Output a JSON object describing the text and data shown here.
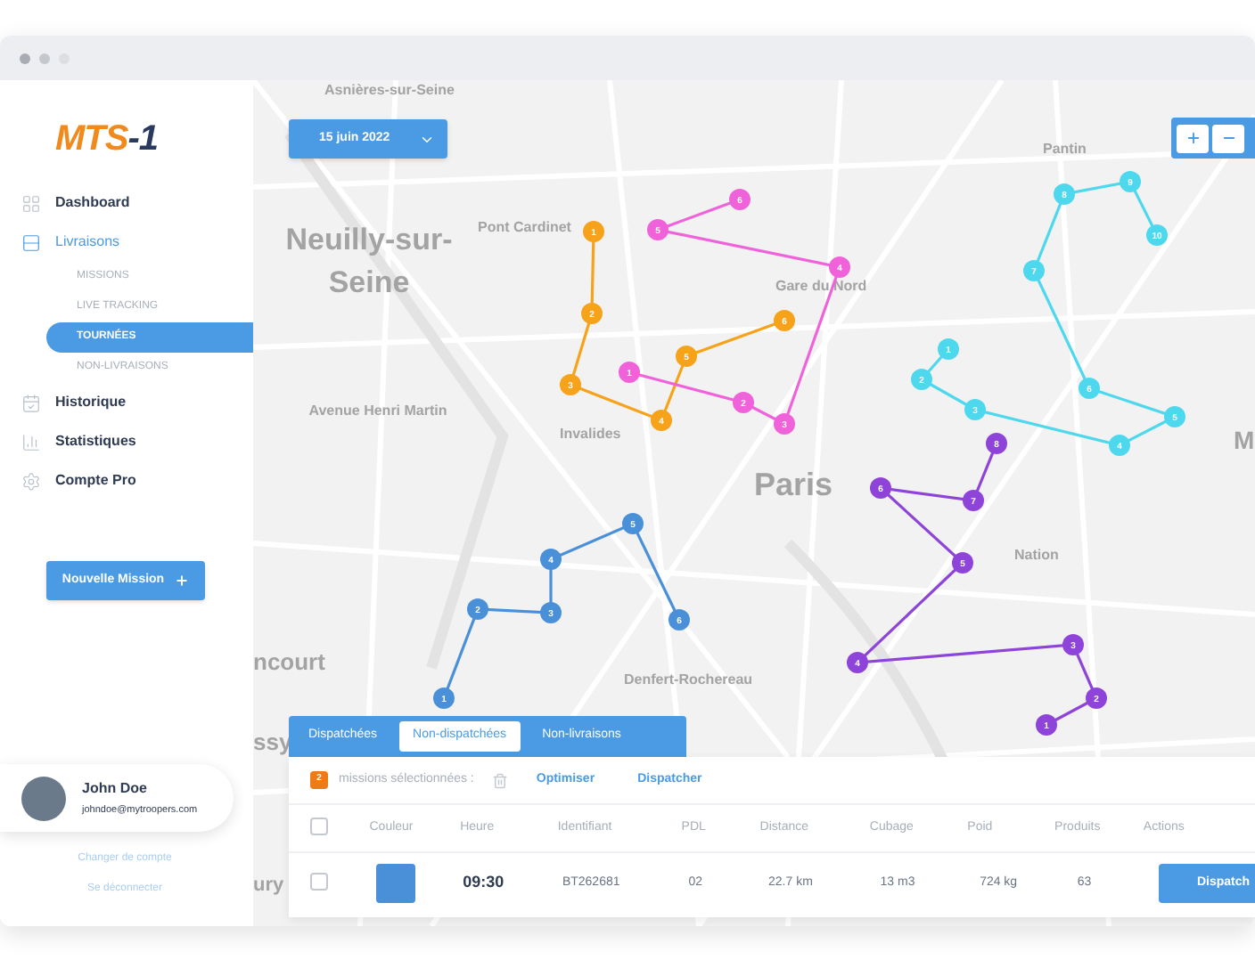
{
  "logo": {
    "main": "MTS",
    "suffix": "-1"
  },
  "nav": [
    {
      "label": "Dashboard",
      "expanded": false
    },
    {
      "label": "Livraisons",
      "expanded": true,
      "children": [
        {
          "label": "MISSIONS",
          "selected": false
        },
        {
          "label": "LIVE TRACKING",
          "selected": false
        },
        {
          "label": "TOURNÉES",
          "selected": true
        },
        {
          "label": "NON-LIVRAISONS",
          "selected": false
        }
      ]
    },
    {
      "label": "Historique",
      "expanded": false
    },
    {
      "label": "Statistiques",
      "expanded": false
    },
    {
      "label": "Compte Pro",
      "expanded": false
    }
  ],
  "new_mission_button": "Nouvelle Mission",
  "user": {
    "name": "John Doe",
    "email": "johndoe@mytroopers.com"
  },
  "account_links": [
    "Changer de compte",
    "Se déconnecter"
  ],
  "date_picker": {
    "value": "15 juin 2022"
  },
  "map_labels": [
    "Asnières-sur-Seine",
    "Neuilly-sur-Seine",
    "Pont Cardinet",
    "Gare du Nord",
    "Pantin",
    "Avenue Henri Martin",
    "Invalides",
    "Paris",
    "Nation",
    "Denfert-Rochereau",
    "ncourt",
    "M",
    "ssy",
    "ury"
  ],
  "routes": [
    {
      "color": "#f7a21b",
      "stops": [
        "1",
        "2",
        "3",
        "4",
        "5",
        "6"
      ]
    },
    {
      "color": "#f062d9",
      "stops": [
        "1",
        "2",
        "3",
        "4",
        "5",
        "6"
      ]
    },
    {
      "color": "#4dd8ee",
      "stops": [
        "1",
        "2",
        "3",
        "4",
        "5",
        "6",
        "7",
        "8",
        "9",
        "10"
      ]
    },
    {
      "color": "#8e44d9",
      "stops": [
        "1",
        "2",
        "3",
        "4",
        "5",
        "6",
        "7",
        "8"
      ]
    },
    {
      "color": "#4a90d9",
      "stops": [
        "1",
        "2",
        "3",
        "4",
        "5",
        "6"
      ]
    }
  ],
  "tabs": [
    {
      "label": "Dispatchées",
      "selected": false
    },
    {
      "label": "Non-dispatchées",
      "selected": true
    },
    {
      "label": "Non-livraisons",
      "selected": false
    }
  ],
  "selection_bar": {
    "count": "2",
    "text": "missions sélectionnées :",
    "actions": [
      "Optimiser",
      "Dispatcher"
    ]
  },
  "table": {
    "select_all_checked": false,
    "columns": [
      "Couleur",
      "Heure",
      "Identifiant",
      "PDL",
      "Distance",
      "Cubage",
      "Poid",
      "Produits",
      "Actions"
    ],
    "rows": [
      {
        "checked": false,
        "color": "#4a90d9",
        "heure": "09:30",
        "identifiant": "BT262681",
        "pdl": "02",
        "distance": "22.7 km",
        "cubage": "13 m3",
        "poid": "724 kg",
        "produits": "63",
        "action": "Dispatch"
      }
    ]
  }
}
